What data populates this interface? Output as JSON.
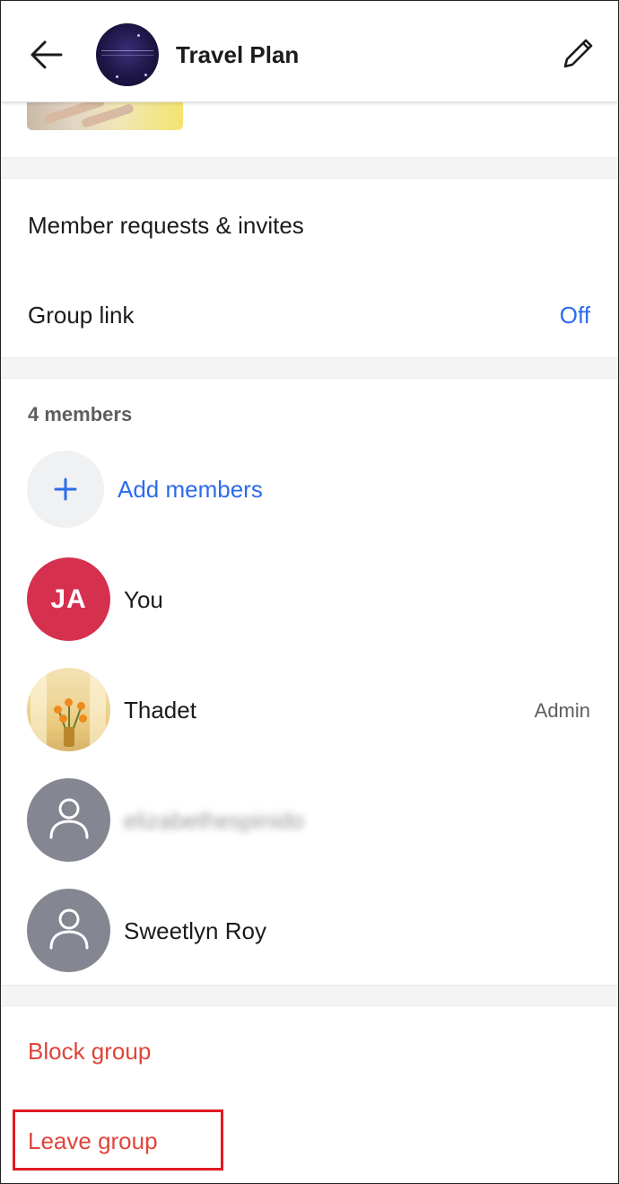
{
  "header": {
    "title": "Travel Plan"
  },
  "settings": {
    "member_requests_label": "Member requests & invites",
    "group_link_label": "Group link",
    "group_link_value": "Off"
  },
  "members": {
    "count_label": "4 members",
    "add_label": "Add members",
    "list": [
      {
        "initials": "JA",
        "name": "You",
        "role": ""
      },
      {
        "name": "Thadet",
        "role": "Admin"
      },
      {
        "name": "elizabethespinido",
        "role": ""
      },
      {
        "name": "Sweetlyn Roy",
        "role": ""
      }
    ]
  },
  "actions": {
    "block_label": "Block group",
    "leave_label": "Leave group"
  },
  "colors": {
    "accent_blue": "#2c6bed",
    "danger_red": "#e0443a",
    "avatar_you": "#d6304f",
    "avatar_generic": "#848691",
    "highlight_box": "#e01b22"
  },
  "icons": [
    "back-arrow-icon",
    "pencil-icon",
    "plus-icon",
    "person-icon"
  ]
}
